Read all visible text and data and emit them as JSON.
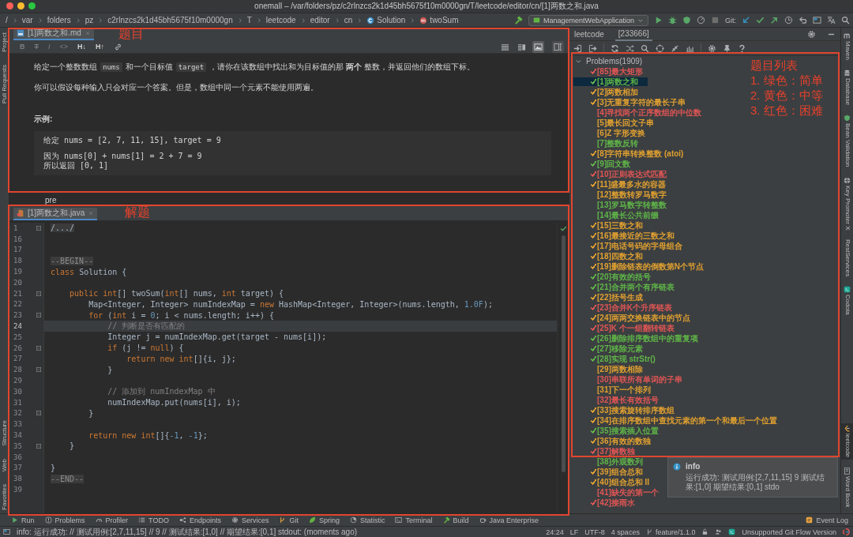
{
  "window": {
    "title": "onemall – /var/folders/pz/c2rlnzcs2k1d45bh5675f10m0000gn/T/leetcode/editor/cn/[1]两数之和.java"
  },
  "breadcrumbs": [
    {
      "kind": "root",
      "text": "/"
    },
    {
      "kind": "folder",
      "text": "var"
    },
    {
      "kind": "folder",
      "text": "folders"
    },
    {
      "kind": "folder",
      "text": "pz"
    },
    {
      "kind": "folder",
      "text": "c2rlnzcs2k1d45bh5675f10m0000gn"
    },
    {
      "kind": "folder",
      "text": "T"
    },
    {
      "kind": "folder",
      "text": "leetcode"
    },
    {
      "kind": "folder",
      "text": "editor"
    },
    {
      "kind": "folder",
      "text": "cn"
    },
    {
      "kind": "class",
      "text": "Solution"
    },
    {
      "kind": "method",
      "text": "twoSum"
    }
  ],
  "toolbar": {
    "run_config": "ManagementWebApplication",
    "git_label": "Git:"
  },
  "left_tool_tabs": {
    "top": [
      {
        "label": "Project"
      },
      {
        "label": "Pull Requests"
      }
    ],
    "bottom": [
      {
        "label": "Structure"
      },
      {
        "label": "Web"
      },
      {
        "label": "Favorites"
      }
    ]
  },
  "right_tool_tabs": {
    "top": [
      {
        "label": "Maven",
        "selected": false
      },
      {
        "label": "Database",
        "selected": false
      },
      {
        "label": "Bean Validation",
        "selected": false
      },
      {
        "label": "Key Promoter X",
        "selected": false
      },
      {
        "label": "RestServices",
        "selected": false
      },
      {
        "label": "Codota",
        "selected": false
      }
    ],
    "bottom": [
      {
        "label": "leetcode",
        "selected": true
      },
      {
        "label": "Word Book",
        "selected": false
      }
    ]
  },
  "markdown_editor": {
    "tab": "[1]两数之和.md",
    "format_buttons": [
      {
        "kind": "bold",
        "label": "B",
        "disabled": true
      },
      {
        "kind": "strike",
        "label": "T",
        "disabled": true
      },
      {
        "kind": "italic",
        "label": "I",
        "disabled": true
      },
      {
        "kind": "code",
        "label": "<>",
        "disabled": true
      },
      {
        "kind": "heading",
        "label": "H↓",
        "disabled": false
      },
      {
        "kind": "heading",
        "label": "H↑",
        "disabled": false
      }
    ],
    "view_modes": [
      {
        "kind": "editor",
        "selected": false
      },
      {
        "kind": "split",
        "selected": false
      },
      {
        "kind": "preview",
        "selected": true
      }
    ],
    "paragraphs": [
      [
        {
          "kind": "text",
          "text": "给定一个整数数组"
        },
        {
          "kind": "code",
          "text": "nums"
        },
        {
          "kind": "text",
          "text": "和一个目标值"
        },
        {
          "kind": "code",
          "text": "target"
        },
        {
          "kind": "text",
          "text": "，请你在该数组中找出和为目标值的那 **两个** 整数，并返回他们的数组下标。"
        }
      ],
      [
        {
          "kind": "text",
          "text": "你可以假设每种输入只会对应一个答案。但是，数组中同一个元素不能使用两遍。"
        }
      ]
    ],
    "example_heading": "示例:",
    "example_block": [
      [
        "给定 nums = [2, 7, 11, 15], target = 9"
      ],
      [
        "因为 nums[0] + nums[1] = 2 + 7 = 9",
        "所以返回 [0, 1]"
      ]
    ],
    "below_text": "pre"
  },
  "code_editor": {
    "tab": "[1]两数之和.java",
    "lines": [
      {
        "number": "1",
        "fold": true,
        "current": false,
        "tokens": [
          {
            "kind": "folded",
            "text": "/.../"
          }
        ]
      },
      {
        "number": "16",
        "fold": false,
        "current": false
      },
      {
        "number": "17",
        "fold": false,
        "current": false
      },
      {
        "number": "18",
        "fold": false,
        "current": false,
        "tokens": [
          {
            "kind": "marker",
            "text": "--BEGIN--"
          }
        ]
      },
      {
        "number": "19",
        "fold": false,
        "current": false,
        "tokens": [
          {
            "kind": "keyword",
            "text": "class"
          },
          {
            "kind": "plain",
            "text": " Solution {"
          }
        ]
      },
      {
        "number": "20",
        "fold": false,
        "current": false
      },
      {
        "number": "21",
        "fold": true,
        "current": false,
        "tokens": [
          {
            "kind": "keyword",
            "text": "    public int"
          },
          {
            "kind": "plain",
            "text": "[] twoSum("
          },
          {
            "kind": "keyword",
            "text": "int"
          },
          {
            "kind": "plain",
            "text": "[] nums, "
          },
          {
            "kind": "keyword",
            "text": "int"
          },
          {
            "kind": "plain",
            "text": " target) {"
          }
        ]
      },
      {
        "number": "22",
        "fold": false,
        "current": false,
        "tokens": [
          {
            "kind": "plain",
            "text": "        Map<Integer, Integer> numIndexMap = "
          },
          {
            "kind": "keyword",
            "text": "new"
          },
          {
            "kind": "plain",
            "text": " HashMap<Integer, Integer>(nums.length, "
          },
          {
            "kind": "number",
            "text": "1.0F"
          },
          {
            "kind": "plain",
            "text": ");"
          }
        ]
      },
      {
        "number": "23",
        "fold": true,
        "current": false,
        "tokens": [
          {
            "kind": "keyword",
            "text": "        for"
          },
          {
            "kind": "plain",
            "text": " ("
          },
          {
            "kind": "keyword",
            "text": "int"
          },
          {
            "kind": "plain",
            "text": " i = "
          },
          {
            "kind": "number",
            "text": "0"
          },
          {
            "kind": "plain",
            "text": "; i < nums.length; i++) {"
          }
        ]
      },
      {
        "number": "24",
        "fold": false,
        "current": true,
        "tokens": [
          {
            "kind": "comment",
            "text": "            // 判断是否有匹配的"
          }
        ]
      },
      {
        "number": "25",
        "fold": false,
        "current": false,
        "tokens": [
          {
            "kind": "plain",
            "text": "            Integer j = numIndexMap.get(target - nums[i]);"
          }
        ]
      },
      {
        "number": "26",
        "fold": true,
        "current": false,
        "tokens": [
          {
            "kind": "keyword",
            "text": "            if"
          },
          {
            "kind": "plain",
            "text": " (j != "
          },
          {
            "kind": "keyword",
            "text": "null"
          },
          {
            "kind": "plain",
            "text": ") {"
          }
        ]
      },
      {
        "number": "27",
        "fold": false,
        "current": false,
        "tokens": [
          {
            "kind": "keyword",
            "text": "                return new int"
          },
          {
            "kind": "plain",
            "text": "[]{i, j};"
          }
        ]
      },
      {
        "number": "28",
        "fold": true,
        "current": false,
        "tokens": [
          {
            "kind": "plain",
            "text": "            }"
          }
        ]
      },
      {
        "number": "29",
        "fold": false,
        "current": false
      },
      {
        "number": "30",
        "fold": false,
        "current": false,
        "tokens": [
          {
            "kind": "comment",
            "text": "            // 添加到 numIndexMap 中"
          }
        ]
      },
      {
        "number": "31",
        "fold": false,
        "current": false,
        "tokens": [
          {
            "kind": "plain",
            "text": "            numIndexMap.put(nums[i], i);"
          }
        ]
      },
      {
        "number": "32",
        "fold": true,
        "current": false,
        "tokens": [
          {
            "kind": "plain",
            "text": "        }"
          }
        ]
      },
      {
        "number": "33",
        "fold": false,
        "current": false
      },
      {
        "number": "34",
        "fold": false,
        "current": false,
        "tokens": [
          {
            "kind": "keyword",
            "text": "        return new int"
          },
          {
            "kind": "plain",
            "text": "[]{"
          },
          {
            "kind": "number",
            "text": "-1"
          },
          {
            "kind": "plain",
            "text": ", "
          },
          {
            "kind": "number",
            "text": "-1"
          },
          {
            "kind": "plain",
            "text": "};"
          }
        ]
      },
      {
        "number": "35",
        "fold": true,
        "current": false,
        "tokens": [
          {
            "kind": "plain",
            "text": "    }"
          }
        ]
      },
      {
        "number": "36",
        "fold": false,
        "current": false
      },
      {
        "number": "37",
        "fold": false,
        "current": false,
        "tokens": [
          {
            "kind": "plain",
            "text": "}"
          }
        ]
      },
      {
        "number": "38",
        "fold": false,
        "current": false,
        "tokens": [
          {
            "kind": "marker",
            "text": "--END--"
          }
        ]
      },
      {
        "number": "39",
        "fold": false,
        "current": false
      }
    ]
  },
  "leetcode_panel": {
    "title": "leetcode",
    "tabs": [
      {
        "label": "[233666]",
        "selected": true
      }
    ],
    "tree": {
      "label": "Problems(1909)",
      "expanded": true,
      "children": [
        {
          "label": "[85]最大矩形",
          "color": "#e05555",
          "solved": true,
          "selected": false
        },
        {
          "label": "[1]两数之和",
          "color": "#5fb548",
          "solved": true,
          "selected": true
        },
        {
          "label": "[2]两数相加",
          "color": "#e0a030",
          "solved": true,
          "selected": false
        },
        {
          "label": "[3]无重复字符的最长子串",
          "color": "#e0a030",
          "solved": true,
          "selected": false
        },
        {
          "label": "[4]寻找两个正序数组的中位数",
          "color": "#e05555",
          "solved": false,
          "selected": false
        },
        {
          "label": "[5]最长回文子串",
          "color": "#e0a030",
          "solved": false,
          "selected": false
        },
        {
          "label": "[6]Z 字形变换",
          "color": "#e0a030",
          "solved": false,
          "selected": false
        },
        {
          "label": "[7]整数反转",
          "color": "#5fb548",
          "solved": false,
          "selected": false
        },
        {
          "label": "[8]字符串转换整数 (atoi)",
          "color": "#e0a030",
          "solved": true,
          "selected": false
        },
        {
          "label": "[9]回文数",
          "color": "#5fb548",
          "solved": true,
          "selected": false
        },
        {
          "label": "[10]正则表达式匹配",
          "color": "#e05555",
          "solved": true,
          "selected": false
        },
        {
          "label": "[11]盛最多水的容器",
          "color": "#e0a030",
          "solved": true,
          "selected": false
        },
        {
          "label": "[12]整数转罗马数字",
          "color": "#e0a030",
          "solved": false,
          "selected": false
        },
        {
          "label": "[13]罗马数字转整数",
          "color": "#5fb548",
          "solved": false,
          "selected": false
        },
        {
          "label": "[14]最长公共前缀",
          "color": "#5fb548",
          "solved": false,
          "selected": false
        },
        {
          "label": "[15]三数之和",
          "color": "#e0a030",
          "solved": true,
          "selected": false
        },
        {
          "label": "[16]最接近的三数之和",
          "color": "#e0a030",
          "solved": true,
          "selected": false
        },
        {
          "label": "[17]电话号码的字母组合",
          "color": "#e0a030",
          "solved": true,
          "selected": false
        },
        {
          "label": "[18]四数之和",
          "color": "#e0a030",
          "solved": true,
          "selected": false
        },
        {
          "label": "[19]删除链表的倒数第N个节点",
          "color": "#e0a030",
          "solved": true,
          "selected": false
        },
        {
          "label": "[20]有效的括号",
          "color": "#5fb548",
          "solved": true,
          "selected": false
        },
        {
          "label": "[21]合并两个有序链表",
          "color": "#5fb548",
          "solved": true,
          "selected": false
        },
        {
          "label": "[22]括号生成",
          "color": "#e0a030",
          "solved": true,
          "selected": false
        },
        {
          "label": "[23]合并K个升序链表",
          "color": "#e05555",
          "solved": true,
          "selected": false
        },
        {
          "label": "[24]两两交换链表中的节点",
          "color": "#e0a030",
          "solved": true,
          "selected": false
        },
        {
          "label": "[25]K 个一组翻转链表",
          "color": "#e05555",
          "solved": true,
          "selected": false
        },
        {
          "label": "[26]删除排序数组中的重复项",
          "color": "#5fb548",
          "solved": true,
          "selected": false
        },
        {
          "label": "[27]移除元素",
          "color": "#5fb548",
          "solved": true,
          "selected": false
        },
        {
          "label": "[28]实现 strStr()",
          "color": "#5fb548",
          "solved": true,
          "selected": false
        },
        {
          "label": "[29]两数相除",
          "color": "#e0a030",
          "solved": false,
          "selected": false
        },
        {
          "label": "[30]串联所有单词的子串",
          "color": "#e05555",
          "solved": false,
          "selected": false
        },
        {
          "label": "[31]下一个排列",
          "color": "#e0a030",
          "solved": false,
          "selected": false
        },
        {
          "label": "[32]最长有效括号",
          "color": "#e05555",
          "solved": false,
          "selected": false
        },
        {
          "label": "[33]搜索旋转排序数组",
          "color": "#e0a030",
          "solved": true,
          "selected": false
        },
        {
          "label": "[34]在排序数组中查找元素的第一个和最后一个位置",
          "color": "#e0a030",
          "solved": true,
          "selected": false
        },
        {
          "label": "[35]搜索插入位置",
          "color": "#5fb548",
          "solved": true,
          "selected": false
        },
        {
          "label": "[36]有效的数独",
          "color": "#e0a030",
          "solved": true,
          "selected": false
        },
        {
          "label": "[37]解数独",
          "color": "#e05555",
          "solved": true,
          "selected": false
        },
        {
          "label": "[38]外观数列",
          "color": "#5fb548",
          "solved": false,
          "selected": false
        },
        {
          "label": "[39]组合总和",
          "color": "#e0a030",
          "solved": true,
          "selected": false
        },
        {
          "label": "[40]组合总和 II",
          "color": "#e0a030",
          "solved": true,
          "selected": false
        },
        {
          "label": "[41]缺失的第一个",
          "color": "#e05555",
          "solved": false,
          "selected": false
        },
        {
          "label": "[42]接雨水",
          "color": "#e05555",
          "solved": true,
          "selected": false
        }
      ]
    }
  },
  "notification": {
    "title": "info",
    "message": "运行成功: 测试用例:[2,7,11,15] 9 测试结果:[1,0] 期望结果:[0,1] stdo"
  },
  "annotations": [
    {
      "kind": "markdown",
      "lines": [
        "题目"
      ]
    },
    {
      "kind": "code",
      "lines": [
        "解题"
      ]
    },
    {
      "kind": "problems",
      "lines": [
        "题目列表",
        "1. 绿色：简单",
        "2. 黄色：中等",
        "3. 红色：困难"
      ]
    }
  ],
  "tool_windows": [
    {
      "kind": "run",
      "label": "Run"
    },
    {
      "kind": "problems",
      "label": "Problems"
    },
    {
      "kind": "profiler",
      "label": "Profiler"
    },
    {
      "kind": "todo",
      "label": "TODO"
    },
    {
      "kind": "endpoints",
      "label": "Endpoints"
    },
    {
      "kind": "services",
      "label": "Services"
    },
    {
      "kind": "git",
      "label": "Git"
    },
    {
      "kind": "spring",
      "label": "Spring"
    },
    {
      "kind": "statistic",
      "label": "Statistic"
    },
    {
      "kind": "terminal",
      "label": "Terminal"
    },
    {
      "kind": "build",
      "label": "Build"
    },
    {
      "kind": "enterprise",
      "label": "Java Enterprise"
    }
  ],
  "event_log": "Event Log",
  "status_bar": {
    "message": "info: 运行成功: // 测试用例:[2,7,11,15] // 9 // 测试结果:[1,0] // 期望结果:[0,1] stdout:  (moments ago)",
    "position": "24:24",
    "line_separator": "LF",
    "encoding": "UTF-8",
    "indent": "4 spaces",
    "branch": "feature/1.1.0",
    "git_flow": "Unsupported Git Flow Version"
  }
}
